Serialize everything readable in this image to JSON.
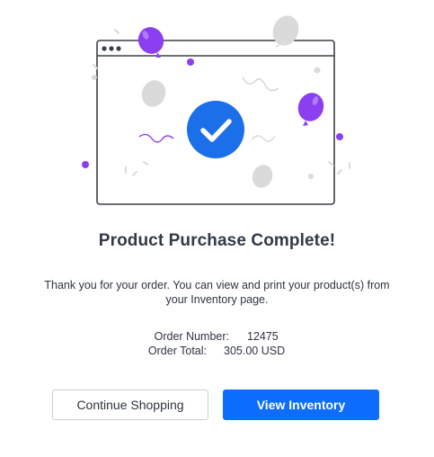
{
  "title": "Product Purchase Complete!",
  "message": "Thank you for your order. You can view and print your product(s) from your Inventory page.",
  "order": {
    "number_label": "Order Number:",
    "number_value": "12475",
    "total_label": "Order Total:",
    "total_value": "305.00 USD"
  },
  "buttons": {
    "continue_shopping": "Continue Shopping",
    "view_inventory": "View Inventory"
  },
  "colors": {
    "primary": "#0d6efd",
    "check_circle": "#1b6fe8",
    "balloon_purple": "#8b3ff0",
    "balloon_gray": "#dadada"
  },
  "icons": {
    "success": "check-circle-icon",
    "window_dots": "ellipsis-icon"
  }
}
